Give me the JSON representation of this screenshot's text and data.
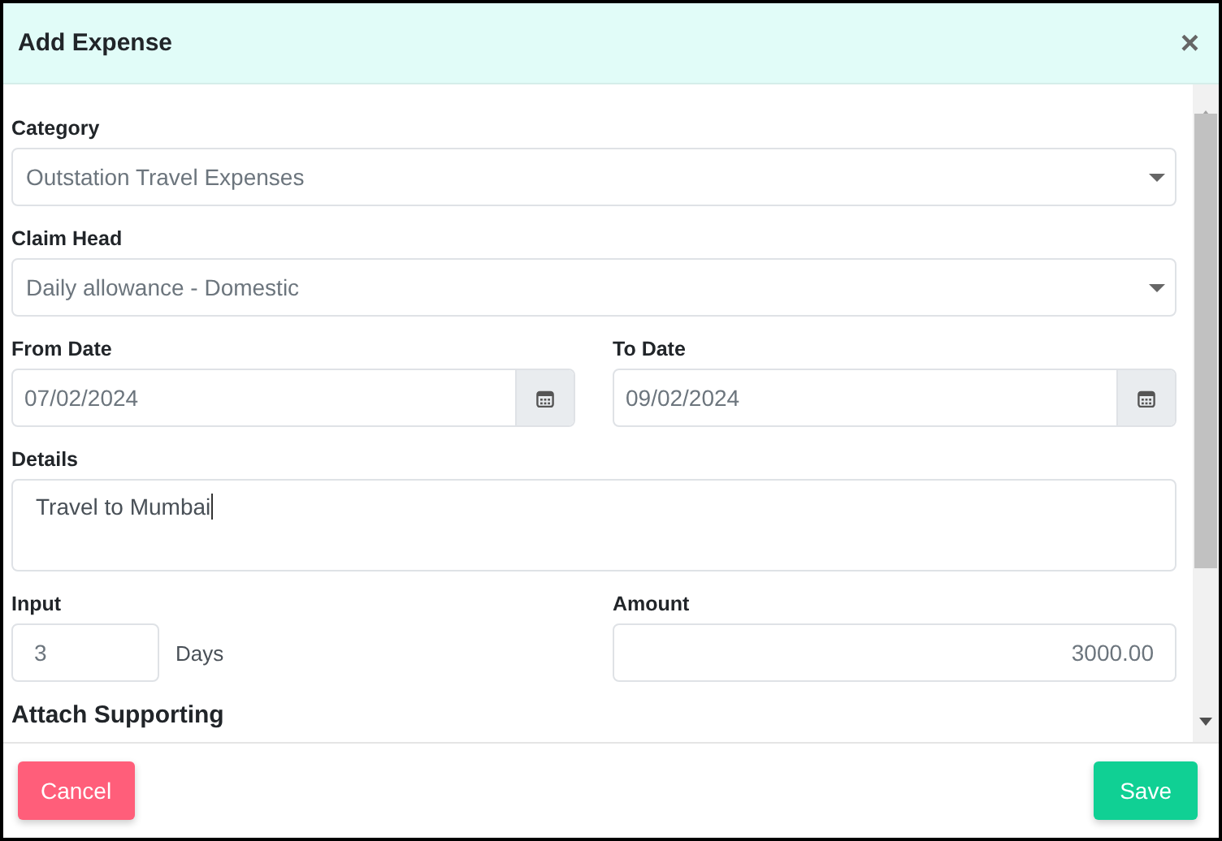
{
  "dialog": {
    "title": "Add Expense",
    "close": "×"
  },
  "rows": [
    [
      {
        "kind": "select",
        "label": "Category",
        "value": "Outstation Travel Expenses"
      }
    ],
    [
      {
        "kind": "select",
        "label": "Claim Head",
        "value": "Daily allowance - Domestic"
      }
    ],
    [
      {
        "kind": "date",
        "label": "From Date",
        "value": "07/02/2024"
      },
      {
        "kind": "date",
        "label": "To Date",
        "value": "09/02/2024"
      }
    ],
    [
      {
        "kind": "textarea",
        "label": "Details",
        "value": "Travel to Mumbai"
      }
    ],
    [
      {
        "kind": "quantity",
        "label": "Input",
        "value": "3",
        "unit": "Days"
      },
      {
        "kind": "amount",
        "label": "Amount",
        "value": "3000.00"
      }
    ]
  ],
  "section_heading": "Attach Supporting",
  "buttons": [
    {
      "kind": "cancel",
      "label": "Cancel"
    },
    {
      "kind": "save",
      "label": "Save"
    }
  ]
}
